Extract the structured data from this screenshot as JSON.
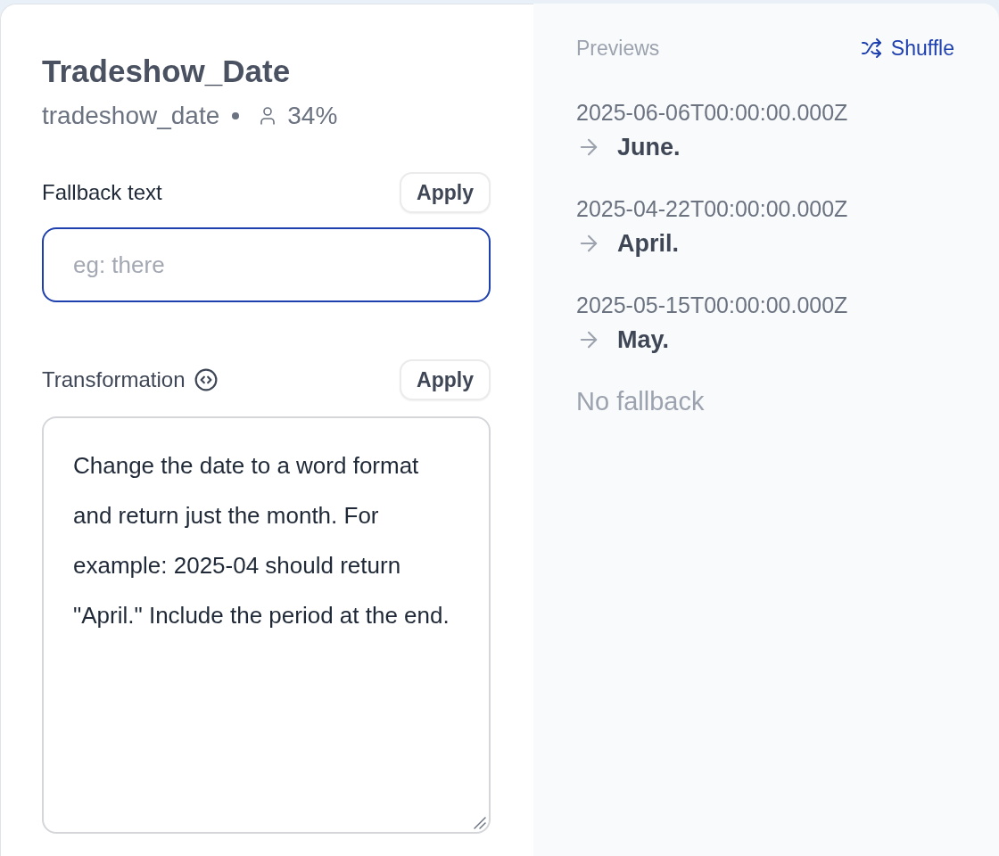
{
  "header": {
    "title": "Tradeshow_Date",
    "key": "tradeshow_date",
    "usage": "34%"
  },
  "fallback": {
    "label": "Fallback text",
    "apply": "Apply",
    "placeholder": "eg: there",
    "focused": true
  },
  "transformation": {
    "label": "Transformation",
    "apply": "Apply",
    "value": "Change the date to a word format and return just the month. For example: 2025-04 should return \"April.\" Include the period at the end.",
    "focused": false
  },
  "previews": {
    "title": "Previews",
    "shuffle": "Shuffle",
    "items": [
      {
        "input": "2025-06-06T00:00:00.000Z",
        "output": "June."
      },
      {
        "input": "2025-04-22T00:00:00.000Z",
        "output": "April."
      },
      {
        "input": "2025-05-15T00:00:00.000Z",
        "output": "May."
      }
    ],
    "fallback_note": "No fallback"
  }
}
